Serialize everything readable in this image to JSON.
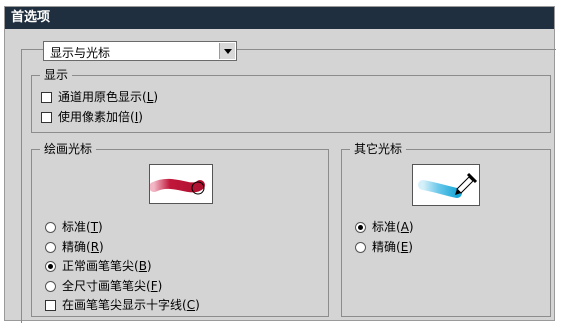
{
  "title": "首选项",
  "dropdown": {
    "value": "显示与光标"
  },
  "display_group": {
    "title": "显示",
    "options": [
      {
        "label": "通道用原色显示(",
        "key": "L",
        "suffix": ")",
        "checked": false
      },
      {
        "label": "使用像素加倍(",
        "key": "I",
        "suffix": ")",
        "checked": false
      }
    ]
  },
  "painting_cursors": {
    "title": "绘画光标",
    "options": [
      {
        "label": "标准(",
        "key": "T",
        "suffix": ")",
        "selected": false
      },
      {
        "label": "精确(",
        "key": "R",
        "suffix": ")",
        "selected": false
      },
      {
        "label": "正常画笔笔尖(",
        "key": "B",
        "suffix": ")",
        "selected": true
      },
      {
        "label": "全尺寸画笔笔尖(",
        "key": "F",
        "suffix": ")",
        "selected": false
      }
    ],
    "checkbox": {
      "label": "在画笔笔尖显示十字线(",
      "key": "C",
      "suffix": ")",
      "checked": false
    }
  },
  "other_cursors": {
    "title": "其它光标",
    "options": [
      {
        "label": "标准(",
        "key": "A",
        "suffix": ")",
        "selected": true
      },
      {
        "label": "精确(",
        "key": "E",
        "suffix": ")",
        "selected": false
      }
    ]
  },
  "colors": {
    "titlebar": "#1f2f3f",
    "dialog_bg": "#d4d4d4",
    "brush_red": "#c0163a",
    "dropper_cyan": "#1aa8d8"
  },
  "icons": {
    "brush_preview": "brush-stroke-icon",
    "dropper_preview": "eyedropper-icon"
  }
}
